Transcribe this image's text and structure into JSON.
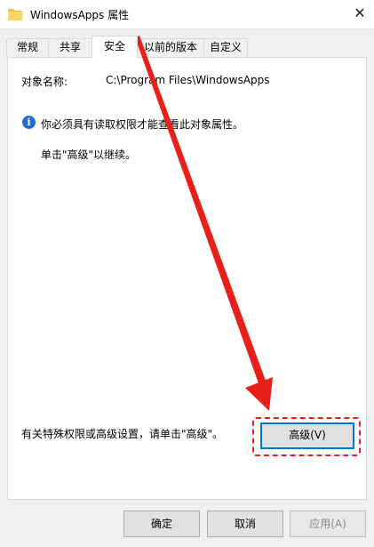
{
  "window": {
    "title": "WindowsApps 属性",
    "close_glyph": "✕",
    "folder_icon": "folder-icon"
  },
  "tabs": [
    {
      "label": "常规"
    },
    {
      "label": "共享"
    },
    {
      "label": "安全",
      "active": true
    },
    {
      "label": "以前的版本"
    },
    {
      "label": "自定义"
    }
  ],
  "security": {
    "object_name_label": "对象名称:",
    "object_name_value": "C:\\Program Files\\WindowsApps",
    "info_message": "你必须具有读取权限才能查看此对象属性。",
    "continue_message": "单击\"高级\"以继续。",
    "special_permissions_text": "有关特殊权限或高级设置，请单击\"高级\"。",
    "advanced_button": "高级(V)"
  },
  "footer": {
    "ok": "确定",
    "cancel": "取消",
    "apply": "应用(A)"
  },
  "colors": {
    "accent": "#0078d7",
    "annotation": "#e8201a",
    "info": "#1e6fcf"
  }
}
